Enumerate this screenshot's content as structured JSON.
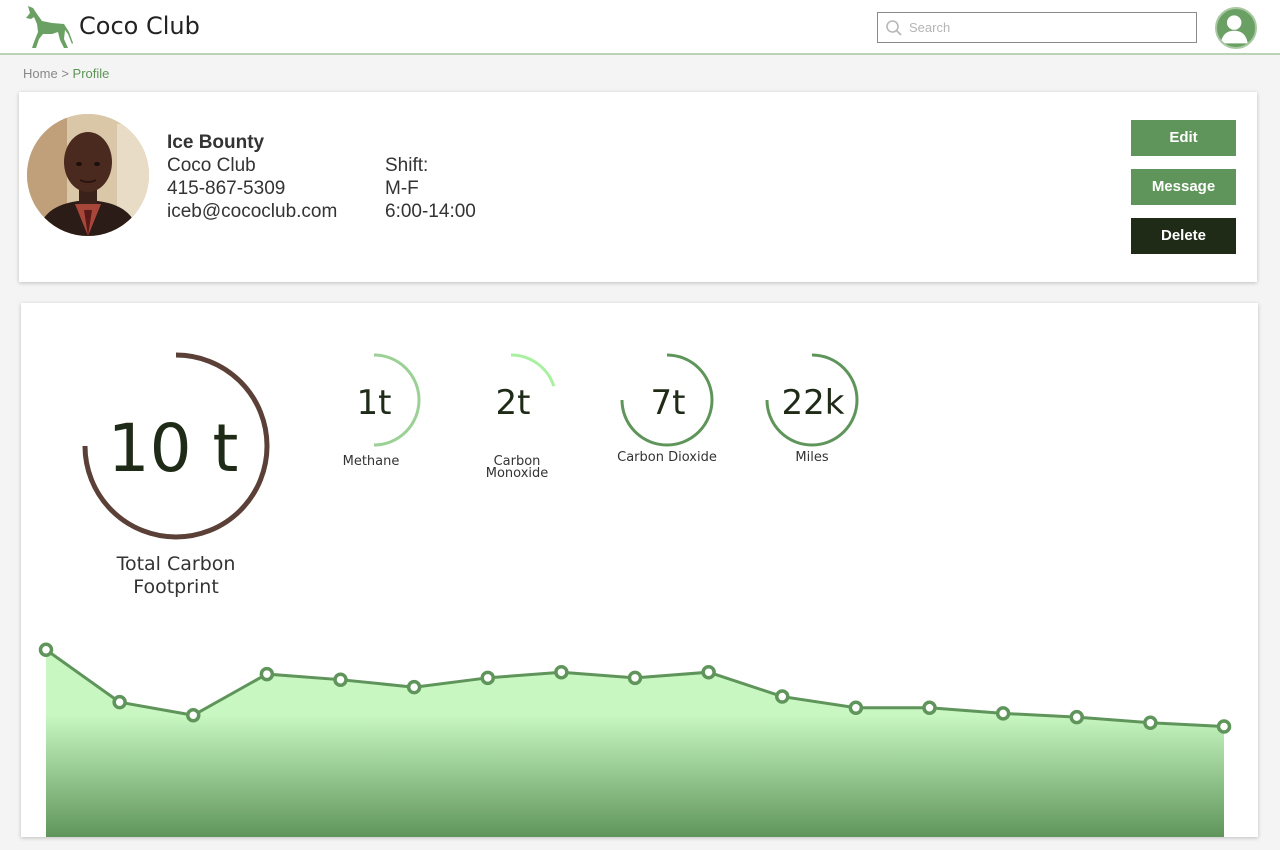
{
  "app": {
    "brand": "Coco Club",
    "logo_icon": "dog-icon",
    "search_placeholder": "Search",
    "accent": "#5f955a",
    "dark_button": "#1f2a17"
  },
  "breadcrumb": {
    "home": "Home",
    "separator": ">",
    "current": "Profile"
  },
  "profile": {
    "name": "Ice Bounty",
    "company": "Coco Club",
    "phone": "415-867-5309",
    "email": "iceb@cococlub.com",
    "shift_label": "Shift:",
    "shift_days": "M-F",
    "shift_hours": "6:00-14:00"
  },
  "actions": {
    "edit": "Edit",
    "message": "Message",
    "delete": "Delete"
  },
  "stats": {
    "total": {
      "value": "10 t",
      "label_line1": "Total Carbon",
      "label_line2": "Footprint",
      "color": "#5b4038",
      "fraction": 0.75
    },
    "gauges": [
      {
        "value": "1t",
        "label": "Methane",
        "color": "#9bd195",
        "fraction": 0.5
      },
      {
        "value": "2t",
        "label": "Carbon Monoxide",
        "color": "#a9f0a0",
        "fraction": 0.2
      },
      {
        "value": "7t",
        "label": "Carbon Dioxide",
        "color": "#5f955a",
        "fraction": 0.75
      },
      {
        "value": "22k",
        "label": "Miles",
        "color": "#5f955a",
        "fraction": 0.75
      }
    ]
  },
  "chart_data": {
    "type": "area",
    "values": [
      100,
      72,
      65,
      87,
      84,
      80,
      85,
      88,
      85,
      88,
      75,
      69,
      69,
      66,
      64,
      61,
      59
    ],
    "ylim": [
      0,
      110
    ],
    "line_color": "#5f955a",
    "fill_top": "#c8f7c2",
    "fill_bottom": "#5f955a",
    "grid": false
  }
}
